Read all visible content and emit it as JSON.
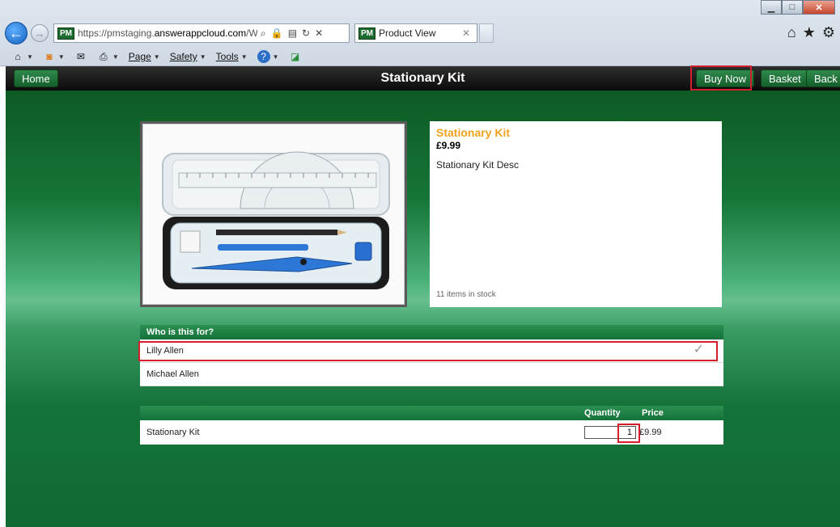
{
  "browser": {
    "url_prefix": "https://pmstaging.",
    "url_domain": "answerappcloud.com",
    "url_suffix": "/Web/",
    "favicon_label": "PM",
    "tab_title": "Product View",
    "menu": {
      "page": "Page",
      "safety": "Safety",
      "tools": "Tools"
    }
  },
  "header": {
    "title": "Stationary Kit",
    "home_label": "Home",
    "buy_now_label": "Buy Now",
    "basket_label": "Basket",
    "back_label": "Back"
  },
  "product": {
    "name": "Stationary Kit",
    "price": "£9.99",
    "description": "Stationary Kit Desc",
    "stock": "11 items in stock"
  },
  "who": {
    "heading": "Who is this for?",
    "people": [
      "Lilly Allen",
      "Michael Allen"
    ],
    "selected": "Lilly Allen"
  },
  "order": {
    "quantity_header": "Quantity",
    "price_header": "Price",
    "item_name": "Stationary Kit",
    "quantity": "1",
    "price": "£9.99"
  },
  "colors": {
    "accent": "#f0a21e",
    "header_green": "#15713a",
    "highlight": "#d21f2b"
  }
}
